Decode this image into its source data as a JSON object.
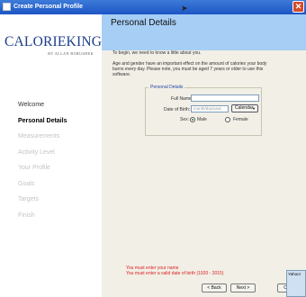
{
  "window": {
    "title": "Create Personal Profile",
    "close_glyph": "✕"
  },
  "logo": {
    "main": "CALORIEKING",
    "sub": "BY ALLAN BORUSHEK"
  },
  "nav": [
    {
      "label": "Welcome",
      "state": "done"
    },
    {
      "label": "Personal Details",
      "state": "current"
    },
    {
      "label": "Measurements",
      "state": "pending"
    },
    {
      "label": "Activity Level",
      "state": "pending"
    },
    {
      "label": "Your Profile",
      "state": "pending"
    },
    {
      "label": "Goals",
      "state": "pending"
    },
    {
      "label": "Targets",
      "state": "pending"
    },
    {
      "label": "Finish",
      "state": "pending"
    }
  ],
  "header": {
    "title": "Personal Details"
  },
  "intro": {
    "line1": "To begin, we need to know a little about you.",
    "line2": "Age and gender have an important effect on the amount of calories your body burns every day. Please note, you must be aged 7 years or older to use this software."
  },
  "form": {
    "legend": "Personal Details",
    "full_name_label": "Full Name:",
    "full_name_value": "",
    "dob_label": "Date of Birth:",
    "dob_placeholder": "month/day/year",
    "calendar_label": "Calendar",
    "sex_label": "Sex:",
    "male_label": "Male",
    "female_label": "Female",
    "selected_sex": "Male"
  },
  "errors": [
    "You must enter your name",
    "You must enter a valid date of birth (1920 - 2015)"
  ],
  "buttons": {
    "back": "< Back",
    "next": "Next >",
    "cancel": "Cancel"
  },
  "tray": {
    "yahoo": "Yahoo!"
  },
  "colors": {
    "header": "#a7cef5",
    "content_bg": "#f1efe6",
    "error": "#dd2222",
    "titlebar": "#2a62cf"
  }
}
